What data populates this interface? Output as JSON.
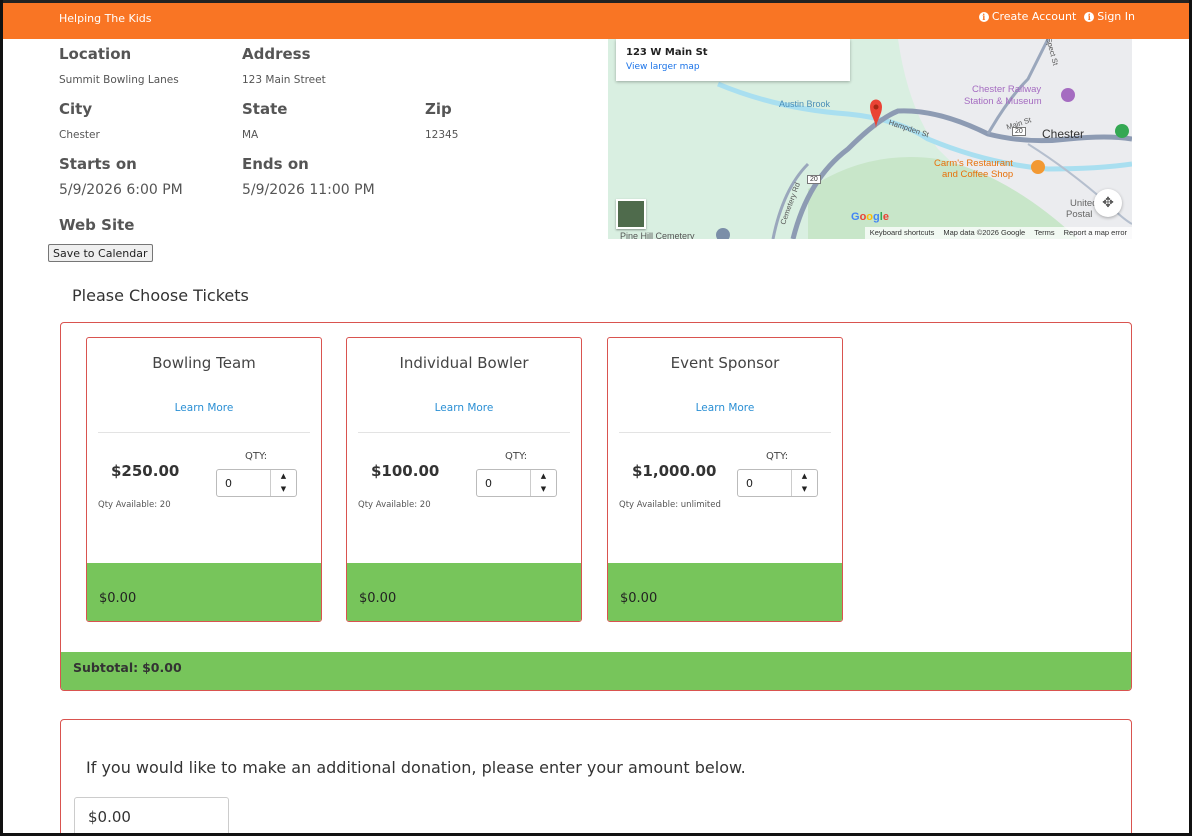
{
  "header": {
    "brand": "Helping The Kids",
    "create_account": "Create Account",
    "sign_in": "Sign In"
  },
  "event": {
    "location_label": "Location",
    "location": "Summit Bowling Lanes",
    "address_label": "Address",
    "address": "123 Main Street",
    "city_label": "City",
    "city": "Chester",
    "state_label": "State",
    "state": "MA",
    "zip_label": "Zip",
    "zip": "12345",
    "starts_label": "Starts on",
    "starts": "5/9/2026 6:00 PM",
    "ends_label": "Ends on",
    "ends": "5/9/2026 11:00 PM",
    "website_label": "Web Site",
    "save_calendar": "Save to Calendar"
  },
  "map": {
    "address": "123 W Main St",
    "view_larger": "View larger map",
    "places": {
      "austin_brook": "Austin Brook",
      "railway_1": "Chester Railway",
      "railway_2": "Station & Museum",
      "chester": "Chester",
      "restaurant_1": "Carm's Restaurant",
      "restaurant_2": "and Coffee Shop",
      "hampden": "Hampden St",
      "main_st": "Main St",
      "cemetery_rd": "Cemetery Rd",
      "pine_hill": "Pine Hill Cemetery",
      "post_office_1": "United",
      "post_office_2": "Postal",
      "spect": "Spect St",
      "route_20": "20",
      "route_20b": "20"
    },
    "google": "Google",
    "footer": [
      "Keyboard shortcuts",
      "Map data ©2026 Google",
      "Terms",
      "Report a map error"
    ],
    "colors": {
      "land": "#d9efe1",
      "road": "#8d9bb3",
      "river": "#a9dff0",
      "pin": "#ea4335"
    }
  },
  "tickets": {
    "title": "Please Choose Tickets",
    "qty_label": "QTY:",
    "learn_more": "Learn More",
    "items": [
      {
        "name": "Bowling Team",
        "price": "$250.00",
        "qty": "0",
        "available": "Qty Available: 20",
        "total": "$0.00"
      },
      {
        "name": "Individual Bowler",
        "price": "$100.00",
        "qty": "0",
        "available": "Qty Available: 20",
        "total": "$0.00"
      },
      {
        "name": "Event Sponsor",
        "price": "$1,000.00",
        "qty": "0",
        "available": "Qty Available: unlimited",
        "total": "$0.00"
      }
    ],
    "subtotal_label": "Subtotal:",
    "subtotal": "$0.00"
  },
  "donation": {
    "prompt": "If you would like to make an additional donation, please enter your amount below.",
    "amount": "$0.00"
  },
  "colors": {
    "header": "#f97524",
    "card_border": "#d9534f",
    "total_bar": "#77c55b",
    "link": "#2a8fd4"
  }
}
